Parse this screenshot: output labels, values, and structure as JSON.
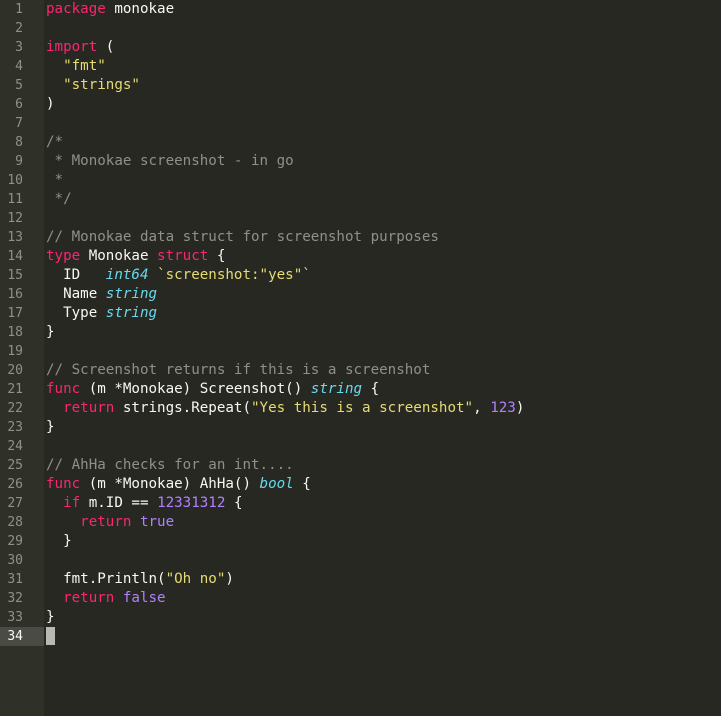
{
  "editor": {
    "current_line": "34",
    "colors": {
      "background": "#272822",
      "gutter": "#2f3129",
      "keyword": "#f92672",
      "string": "#e6db74",
      "comment": "#8f908a",
      "type": "#66d9ef",
      "number": "#ae81ff",
      "text": "#f8f8f2"
    },
    "lines": [
      {
        "n": "1",
        "tokens": [
          {
            "t": "keyword",
            "v": "package"
          },
          {
            "t": "plain",
            "v": " monokae"
          }
        ]
      },
      {
        "n": "2",
        "tokens": []
      },
      {
        "n": "3",
        "tokens": [
          {
            "t": "keyword",
            "v": "import"
          },
          {
            "t": "plain",
            "v": " ("
          }
        ]
      },
      {
        "n": "4",
        "tokens": [
          {
            "t": "plain",
            "v": "  "
          },
          {
            "t": "string",
            "v": "\"fmt\""
          }
        ]
      },
      {
        "n": "5",
        "tokens": [
          {
            "t": "plain",
            "v": "  "
          },
          {
            "t": "string",
            "v": "\"strings\""
          }
        ]
      },
      {
        "n": "6",
        "tokens": [
          {
            "t": "plain",
            "v": ")"
          }
        ]
      },
      {
        "n": "7",
        "tokens": []
      },
      {
        "n": "8",
        "tokens": [
          {
            "t": "comment",
            "v": "/*"
          }
        ]
      },
      {
        "n": "9",
        "tokens": [
          {
            "t": "comment",
            "v": " * Monokae screenshot - in go"
          }
        ]
      },
      {
        "n": "10",
        "tokens": [
          {
            "t": "comment",
            "v": " *"
          }
        ]
      },
      {
        "n": "11",
        "tokens": [
          {
            "t": "comment",
            "v": " */"
          }
        ]
      },
      {
        "n": "12",
        "tokens": []
      },
      {
        "n": "13",
        "tokens": [
          {
            "t": "comment",
            "v": "// Monokae data struct for screenshot purposes"
          }
        ]
      },
      {
        "n": "14",
        "tokens": [
          {
            "t": "keyword",
            "v": "type"
          },
          {
            "t": "plain",
            "v": " Monokae "
          },
          {
            "t": "keyword",
            "v": "struct"
          },
          {
            "t": "plain",
            "v": " {"
          }
        ]
      },
      {
        "n": "15",
        "tokens": [
          {
            "t": "plain",
            "v": "  ID   "
          },
          {
            "t": "type",
            "v": "int64"
          },
          {
            "t": "plain",
            "v": " "
          },
          {
            "t": "string",
            "v": "`screenshot:\"yes\"`"
          }
        ]
      },
      {
        "n": "16",
        "tokens": [
          {
            "t": "plain",
            "v": "  Name "
          },
          {
            "t": "type",
            "v": "string"
          }
        ]
      },
      {
        "n": "17",
        "tokens": [
          {
            "t": "plain",
            "v": "  Type "
          },
          {
            "t": "type",
            "v": "string"
          }
        ]
      },
      {
        "n": "18",
        "tokens": [
          {
            "t": "plain",
            "v": "}"
          }
        ]
      },
      {
        "n": "19",
        "tokens": []
      },
      {
        "n": "20",
        "tokens": [
          {
            "t": "comment",
            "v": "// Screenshot returns if this is a screenshot"
          }
        ]
      },
      {
        "n": "21",
        "tokens": [
          {
            "t": "keyword",
            "v": "func"
          },
          {
            "t": "plain",
            "v": " (m *Monokae) Screenshot() "
          },
          {
            "t": "type",
            "v": "string"
          },
          {
            "t": "plain",
            "v": " {"
          }
        ]
      },
      {
        "n": "22",
        "tokens": [
          {
            "t": "plain",
            "v": "  "
          },
          {
            "t": "keyword",
            "v": "return"
          },
          {
            "t": "plain",
            "v": " strings.Repeat("
          },
          {
            "t": "string",
            "v": "\"Yes this is a screenshot\""
          },
          {
            "t": "plain",
            "v": ", "
          },
          {
            "t": "number",
            "v": "123"
          },
          {
            "t": "plain",
            "v": ")"
          }
        ]
      },
      {
        "n": "23",
        "tokens": [
          {
            "t": "plain",
            "v": "}"
          }
        ]
      },
      {
        "n": "24",
        "tokens": []
      },
      {
        "n": "25",
        "tokens": [
          {
            "t": "comment",
            "v": "// AhHa checks for an int...."
          }
        ]
      },
      {
        "n": "26",
        "tokens": [
          {
            "t": "keyword",
            "v": "func"
          },
          {
            "t": "plain",
            "v": " (m *Monokae) AhHa() "
          },
          {
            "t": "type",
            "v": "bool"
          },
          {
            "t": "plain",
            "v": " {"
          }
        ]
      },
      {
        "n": "27",
        "tokens": [
          {
            "t": "plain",
            "v": "  "
          },
          {
            "t": "keyword",
            "v": "if"
          },
          {
            "t": "plain",
            "v": " m.ID == "
          },
          {
            "t": "number",
            "v": "12331312"
          },
          {
            "t": "plain",
            "v": " {"
          }
        ]
      },
      {
        "n": "28",
        "tokens": [
          {
            "t": "plain",
            "v": "    "
          },
          {
            "t": "keyword",
            "v": "return"
          },
          {
            "t": "plain",
            "v": " "
          },
          {
            "t": "const",
            "v": "true"
          }
        ]
      },
      {
        "n": "29",
        "tokens": [
          {
            "t": "plain",
            "v": "  }"
          }
        ]
      },
      {
        "n": "30",
        "tokens": []
      },
      {
        "n": "31",
        "tokens": [
          {
            "t": "plain",
            "v": "  fmt.Println("
          },
          {
            "t": "string",
            "v": "\"Oh no\""
          },
          {
            "t": "plain",
            "v": ")"
          }
        ]
      },
      {
        "n": "32",
        "tokens": [
          {
            "t": "plain",
            "v": "  "
          },
          {
            "t": "keyword",
            "v": "return"
          },
          {
            "t": "plain",
            "v": " "
          },
          {
            "t": "const",
            "v": "false"
          }
        ]
      },
      {
        "n": "33",
        "tokens": [
          {
            "t": "plain",
            "v": "}"
          }
        ]
      },
      {
        "n": "34",
        "tokens": []
      }
    ]
  }
}
